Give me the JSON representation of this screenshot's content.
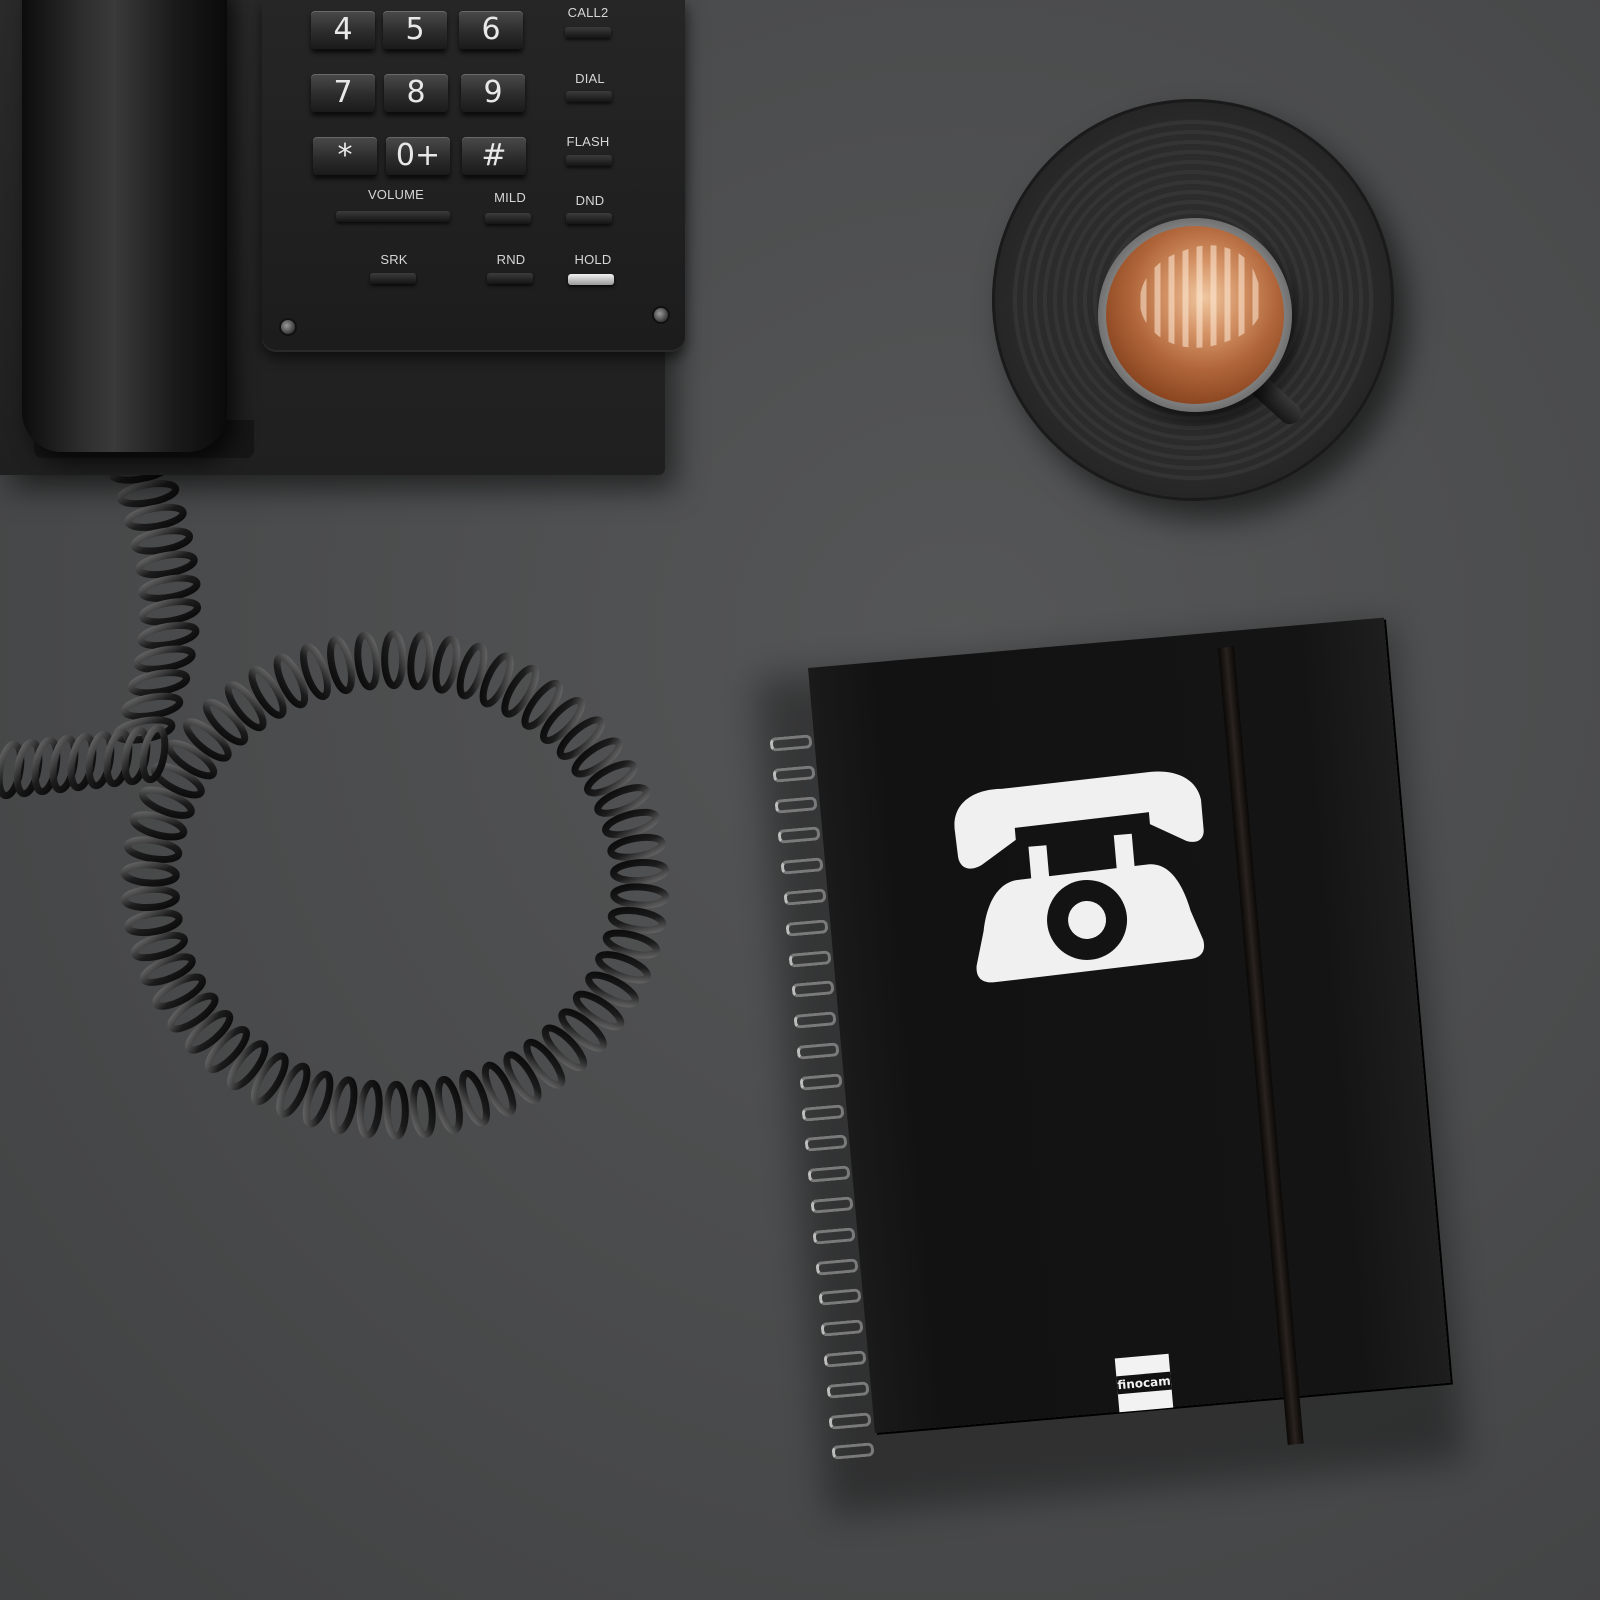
{
  "phone": {
    "keys": [
      "4",
      "5",
      "6",
      "7",
      "8",
      "9",
      "*",
      "0+",
      "#"
    ],
    "function_labels": {
      "call2": "CALL2",
      "dial": "DIAL",
      "flash": "FLASH",
      "volume": "VOLUME",
      "mild": "MILD",
      "dnd": "DND",
      "srk": "SRK",
      "rnd": "RND",
      "hold": "HOLD"
    }
  },
  "notebook": {
    "brand": "finocam",
    "cover_icon": "telephone-icon"
  },
  "colors": {
    "desk": "#4a4b4c",
    "notebook_cover": "#131313",
    "icon": "#f0f0f0",
    "coffee": "#b0663a"
  }
}
